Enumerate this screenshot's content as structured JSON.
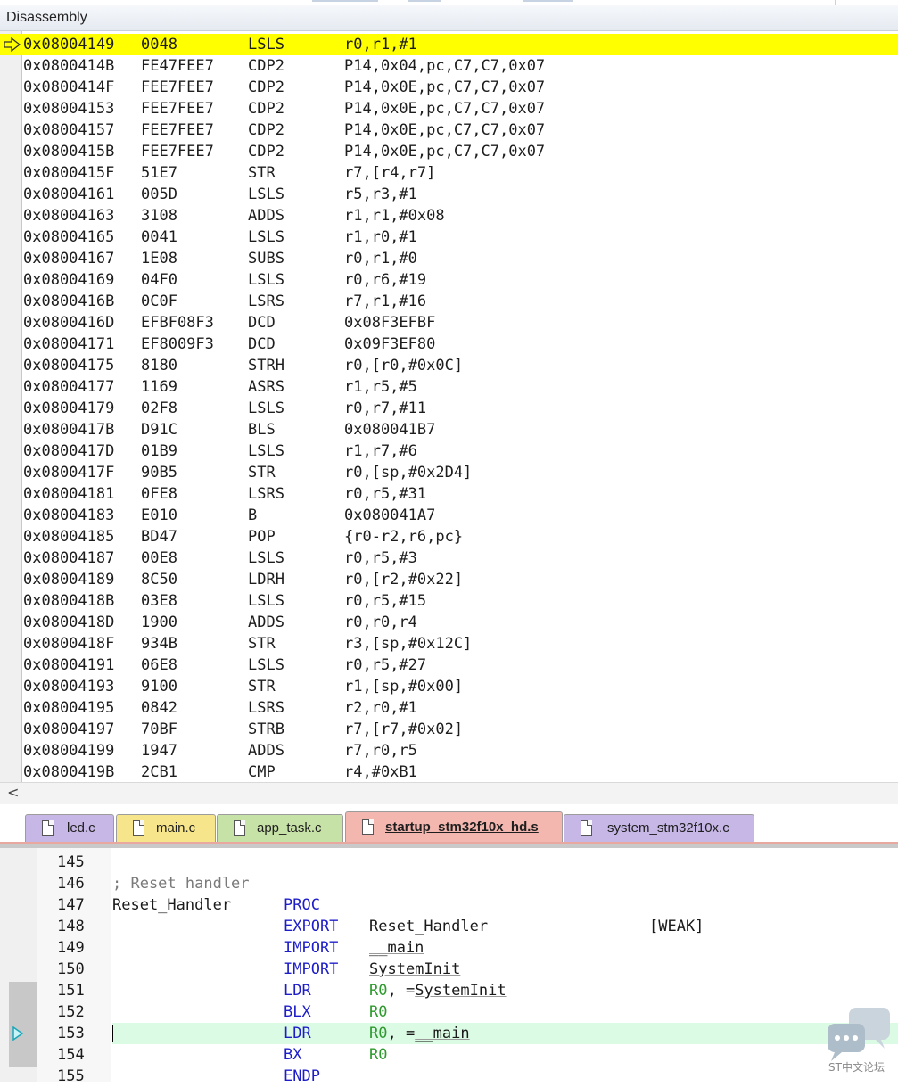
{
  "disassembly": {
    "title": "Disassembly",
    "current_index": 0,
    "rows": [
      {
        "addr": "0x08004149",
        "opcode": "0048",
        "mnem": "LSLS",
        "ops": "r0,r1,#1"
      },
      {
        "addr": "0x0800414B",
        "opcode": "FE47FEE7",
        "mnem": "CDP2",
        "ops": "P14,0x04,pc,C7,C7,0x07"
      },
      {
        "addr": "0x0800414F",
        "opcode": "FEE7FEE7",
        "mnem": "CDP2",
        "ops": "P14,0x0E,pc,C7,C7,0x07"
      },
      {
        "addr": "0x08004153",
        "opcode": "FEE7FEE7",
        "mnem": "CDP2",
        "ops": "P14,0x0E,pc,C7,C7,0x07"
      },
      {
        "addr": "0x08004157",
        "opcode": "FEE7FEE7",
        "mnem": "CDP2",
        "ops": "P14,0x0E,pc,C7,C7,0x07"
      },
      {
        "addr": "0x0800415B",
        "opcode": "FEE7FEE7",
        "mnem": "CDP2",
        "ops": "P14,0x0E,pc,C7,C7,0x07"
      },
      {
        "addr": "0x0800415F",
        "opcode": "51E7",
        "mnem": "STR",
        "ops": "r7,[r4,r7]"
      },
      {
        "addr": "0x08004161",
        "opcode": "005D",
        "mnem": "LSLS",
        "ops": "r5,r3,#1"
      },
      {
        "addr": "0x08004163",
        "opcode": "3108",
        "mnem": "ADDS",
        "ops": "r1,r1,#0x08"
      },
      {
        "addr": "0x08004165",
        "opcode": "0041",
        "mnem": "LSLS",
        "ops": "r1,r0,#1"
      },
      {
        "addr": "0x08004167",
        "opcode": "1E08",
        "mnem": "SUBS",
        "ops": "r0,r1,#0"
      },
      {
        "addr": "0x08004169",
        "opcode": "04F0",
        "mnem": "LSLS",
        "ops": "r0,r6,#19"
      },
      {
        "addr": "0x0800416B",
        "opcode": "0C0F",
        "mnem": "LSRS",
        "ops": "r7,r1,#16"
      },
      {
        "addr": "0x0800416D",
        "opcode": "EFBF08F3",
        "mnem": "DCD",
        "ops": "0x08F3EFBF"
      },
      {
        "addr": "0x08004171",
        "opcode": "EF8009F3",
        "mnem": "DCD",
        "ops": "0x09F3EF80"
      },
      {
        "addr": "0x08004175",
        "opcode": "8180",
        "mnem": "STRH",
        "ops": "r0,[r0,#0x0C]"
      },
      {
        "addr": "0x08004177",
        "opcode": "1169",
        "mnem": "ASRS",
        "ops": "r1,r5,#5"
      },
      {
        "addr": "0x08004179",
        "opcode": "02F8",
        "mnem": "LSLS",
        "ops": "r0,r7,#11"
      },
      {
        "addr": "0x0800417B",
        "opcode": "D91C",
        "mnem": "BLS",
        "ops": "0x080041B7"
      },
      {
        "addr": "0x0800417D",
        "opcode": "01B9",
        "mnem": "LSLS",
        "ops": "r1,r7,#6"
      },
      {
        "addr": "0x0800417F",
        "opcode": "90B5",
        "mnem": "STR",
        "ops": "r0,[sp,#0x2D4]"
      },
      {
        "addr": "0x08004181",
        "opcode": "0FE8",
        "mnem": "LSRS",
        "ops": "r0,r5,#31"
      },
      {
        "addr": "0x08004183",
        "opcode": "E010",
        "mnem": "B",
        "ops": "0x080041A7"
      },
      {
        "addr": "0x08004185",
        "opcode": "BD47",
        "mnem": "POP",
        "ops": "{r0-r2,r6,pc}"
      },
      {
        "addr": "0x08004187",
        "opcode": "00E8",
        "mnem": "LSLS",
        "ops": "r0,r5,#3"
      },
      {
        "addr": "0x08004189",
        "opcode": "8C50",
        "mnem": "LDRH",
        "ops": "r0,[r2,#0x22]"
      },
      {
        "addr": "0x0800418B",
        "opcode": "03E8",
        "mnem": "LSLS",
        "ops": "r0,r5,#15"
      },
      {
        "addr": "0x0800418D",
        "opcode": "1900",
        "mnem": "ADDS",
        "ops": "r0,r0,r4"
      },
      {
        "addr": "0x0800418F",
        "opcode": "934B",
        "mnem": "STR",
        "ops": "r3,[sp,#0x12C]"
      },
      {
        "addr": "0x08004191",
        "opcode": "06E8",
        "mnem": "LSLS",
        "ops": "r0,r5,#27"
      },
      {
        "addr": "0x08004193",
        "opcode": "9100",
        "mnem": "STR",
        "ops": "r1,[sp,#0x00]"
      },
      {
        "addr": "0x08004195",
        "opcode": "0842",
        "mnem": "LSRS",
        "ops": "r2,r0,#1"
      },
      {
        "addr": "0x08004197",
        "opcode": "70BF",
        "mnem": "STRB",
        "ops": "r7,[r7,#0x02]"
      },
      {
        "addr": "0x08004199",
        "opcode": "1947",
        "mnem": "ADDS",
        "ops": "r7,r0,r5"
      },
      {
        "addr": "0x0800419B",
        "opcode": "2CB1",
        "mnem": "CMP",
        "ops": "r4,#0xB1"
      }
    ],
    "hscroll_left": "<"
  },
  "tabs": [
    {
      "label": "led.c",
      "color": "#c7b7e6",
      "active": false
    },
    {
      "label": "main.c",
      "color": "#f6e58a",
      "active": false
    },
    {
      "label": "app_task.c",
      "color": "#c7e2a6",
      "active": false
    },
    {
      "label": "startup_stm32f10x_hd.s",
      "color": "#f4b7b0",
      "active": true
    },
    {
      "label": "system_stm32f10x.c",
      "color": "#c7b7e6",
      "active": false
    }
  ],
  "editor": {
    "current_line": 153,
    "lines": [
      {
        "num": "145"
      },
      {
        "num": "146",
        "comment": "; Reset handler"
      },
      {
        "num": "147",
        "label": "Reset_Handler",
        "kw": "PROC"
      },
      {
        "num": "148",
        "kw": "EXPORT",
        "arg": "Reset_Handler",
        "extra": "[WEAK]"
      },
      {
        "num": "149",
        "kw": "IMPORT",
        "sym": "__main"
      },
      {
        "num": "150",
        "kw": "IMPORT",
        "sym": "SystemInit"
      },
      {
        "num": "151",
        "kw": "LDR",
        "reg": "R0",
        "sep": ", =",
        "sym2": "SystemInit"
      },
      {
        "num": "152",
        "kw": "BLX",
        "reg": "R0"
      },
      {
        "num": "153",
        "kw": "LDR",
        "reg": "R0",
        "sep": ", =",
        "sym2": "__main"
      },
      {
        "num": "154",
        "kw": "BX",
        "reg": "R0"
      },
      {
        "num": "155",
        "kw": "ENDP"
      }
    ]
  },
  "watermark": {
    "text": "ST中文论坛"
  }
}
